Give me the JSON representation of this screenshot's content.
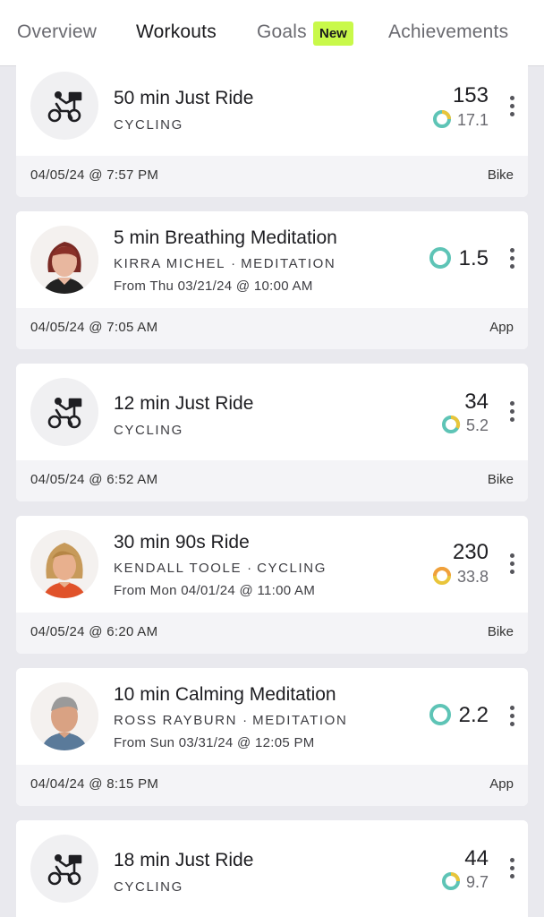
{
  "tabs": [
    {
      "label": "Overview",
      "active": false
    },
    {
      "label": "Workouts",
      "active": true
    },
    {
      "label": "Goals",
      "active": false,
      "badge": "New"
    },
    {
      "label": "Achievements",
      "active": false
    }
  ],
  "colors": {
    "badge": "#c9f94a",
    "ring_teal": "#5ec4b6",
    "ring_yellow": "#e9c53a",
    "ring_orange": "#f0a03c"
  },
  "workouts": [
    {
      "title": "50 min Just Ride",
      "instructor": "",
      "category": "CYCLING",
      "scheduled": "",
      "output": "153",
      "strain": "17.1",
      "date": "04/05/24 @ 7:57 PM",
      "source": "Bike",
      "icon": "bike-icon"
    },
    {
      "title": "5 min Breathing Meditation",
      "instructor": "KIRRA MICHEL",
      "category": "MEDITATION",
      "scheduled": "From Thu 03/21/24 @ 10:00 AM",
      "output": "",
      "strain": "1.5",
      "date": "04/05/24 @ 7:05 AM",
      "source": "App",
      "icon": "instructor-avatar"
    },
    {
      "title": "12 min Just Ride",
      "instructor": "",
      "category": "CYCLING",
      "scheduled": "",
      "output": "34",
      "strain": "5.2",
      "date": "04/05/24 @ 6:52 AM",
      "source": "Bike",
      "icon": "bike-icon"
    },
    {
      "title": "30 min 90s Ride",
      "instructor": "KENDALL TOOLE",
      "category": "CYCLING",
      "scheduled": "From Mon 04/01/24 @ 11:00 AM",
      "output": "230",
      "strain": "33.8",
      "date": "04/05/24 @ 6:20 AM",
      "source": "Bike",
      "icon": "instructor-avatar"
    },
    {
      "title": "10 min Calming Meditation",
      "instructor": "ROSS RAYBURN",
      "category": "MEDITATION",
      "scheduled": "From Sun 03/31/24 @ 12:05 PM",
      "output": "",
      "strain": "2.2",
      "date": "04/04/24 @ 8:15 PM",
      "source": "App",
      "icon": "instructor-avatar"
    },
    {
      "title": "18 min Just Ride",
      "instructor": "",
      "category": "CYCLING",
      "scheduled": "",
      "output": "44",
      "strain": "9.7",
      "date": "",
      "source": "",
      "icon": "bike-icon"
    }
  ]
}
